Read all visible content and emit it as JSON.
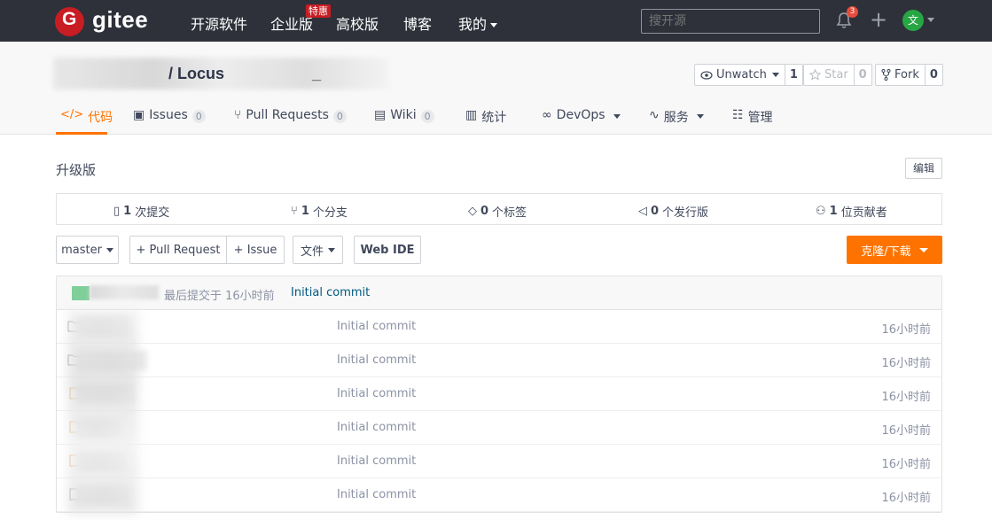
{
  "nav": {
    "brand": "gitee",
    "logo_letter": "G",
    "links": [
      "开源软件",
      "企业版",
      "高校版",
      "博客",
      "我的"
    ],
    "hot_badge": "特惠",
    "search_placeholder": "搜开源",
    "notification_count": "3",
    "avatar_letter": "文"
  },
  "project": {
    "title_visible": "/ Locus",
    "title_tail": "_",
    "unwatch": {
      "label": "Unwatch",
      "count": "1"
    },
    "star": {
      "label": "Star",
      "count": "0"
    },
    "fork": {
      "label": "Fork",
      "count": "0"
    },
    "tabs": [
      {
        "label": "代码",
        "count": null,
        "icon": "code-icon"
      },
      {
        "label": "Issues",
        "count": "0",
        "icon": "issues-icon"
      },
      {
        "label": "Pull Requests",
        "count": "0",
        "icon": "pull-request-icon"
      },
      {
        "label": "Wiki",
        "count": "0",
        "icon": "wiki-icon"
      },
      {
        "label": "统计",
        "count": null,
        "icon": "stats-icon"
      },
      {
        "label": "DevOps",
        "count": null,
        "icon": "devops-icon"
      },
      {
        "label": "服务",
        "count": null,
        "icon": "service-icon"
      },
      {
        "label": "管理",
        "count": null,
        "icon": "manage-icon"
      }
    ]
  },
  "repo": {
    "description": "升级版",
    "edit_label": "编辑",
    "stats": [
      {
        "num": "1",
        "label": "次提交",
        "icon": "commit-icon"
      },
      {
        "num": "1",
        "label": "个分支",
        "icon": "branch-icon"
      },
      {
        "num": "0",
        "label": "个标签",
        "icon": "tag-icon"
      },
      {
        "num": "0",
        "label": "个发行版",
        "icon": "release-icon"
      },
      {
        "num": "1",
        "label": "位贡献者",
        "icon": "contributor-icon"
      }
    ],
    "branch": "master",
    "pull_request_btn": "+ Pull Request",
    "issue_btn": "+ Issue",
    "file_btn": "文件",
    "webide_btn": "Web IDE",
    "clone_btn": "克隆/下载",
    "last_commit_text": "最后提交于 16小时前",
    "last_commit_msg": "Initial commit",
    "files": [
      {
        "type": "folder",
        "msg": "Initial commit",
        "time": "16小时前"
      },
      {
        "type": "folder",
        "msg": "Initial commit",
        "time": "16小时前"
      },
      {
        "type": "file",
        "msg": "Initial commit",
        "time": "16小时前"
      },
      {
        "type": "file",
        "msg": "Initial commit",
        "time": "16小时前"
      },
      {
        "type": "file",
        "msg": "Initial commit",
        "time": "16小时前"
      },
      {
        "type": "file",
        "msg": "Initial commit",
        "time": "16小时前"
      }
    ]
  },
  "colors": {
    "accent": "#fe7300",
    "nav_bg": "#2e313a",
    "logo_red": "#c71d23",
    "link_blue": "#005980"
  }
}
